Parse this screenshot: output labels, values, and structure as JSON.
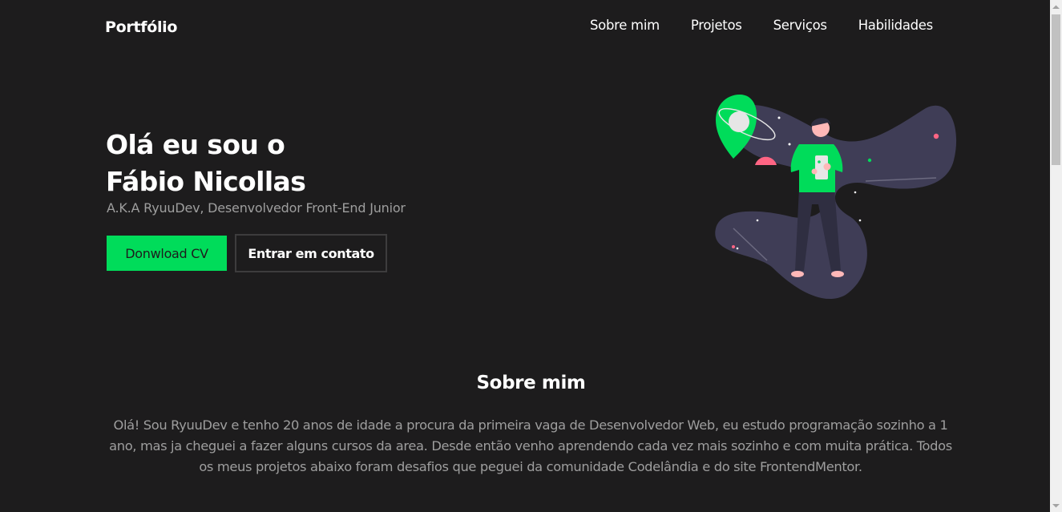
{
  "header": {
    "logo": "Portfólio",
    "nav": [
      "Sobre mim",
      "Projetos",
      "Serviços",
      "Habilidades"
    ]
  },
  "hero": {
    "title_line1": "Olá eu sou o",
    "title_line2": "Fábio Nicollas",
    "subtitle": "A.K.A RyuuDev, Desenvolvedor Front-End Junior",
    "primary_button": "Donwload CV",
    "secondary_button": "Entrar em contato",
    "illustration_icon": "astronaut-phone-illustration"
  },
  "about": {
    "title": "Sobre mim",
    "text": "Olá! Sou RyuuDev e tenho 20 anos de idade a procura da primeira vaga de Desenvolvedor Web, eu estudo programação sozinho a 1 ano, mas ja cheguei a fazer alguns cursos da area. Desde então venho aprendendo cada vez mais sozinho e com muita prática. Todos os meus projetos abaixo foram desafios que peguei da comunidade Codelândia e do site FrontendMentor."
  },
  "colors": {
    "background": "#1d1c1d",
    "accent": "#00dc5a",
    "muted_text": "#9e9e9e"
  }
}
